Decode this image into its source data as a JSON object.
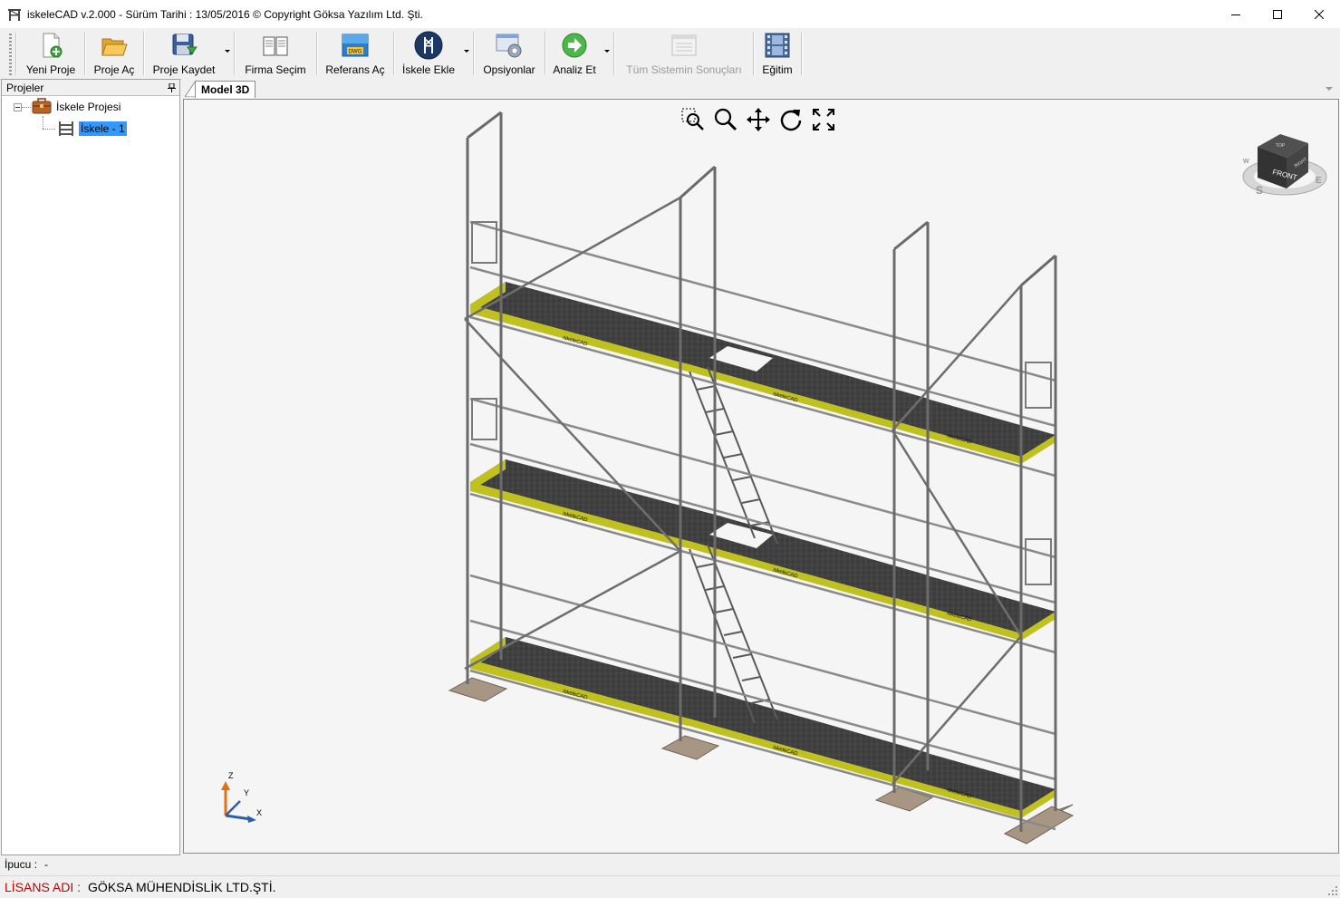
{
  "window": {
    "title": "iskeleCAD v.2.000 - Sürüm Tarihi : 13/05/2016  © Copyright Göksa Yazılım Ltd. Şti."
  },
  "toolbar": {
    "buttons": [
      {
        "label": "Yeni Proje",
        "icon": "new-project-icon"
      },
      {
        "label": "Proje Aç",
        "icon": "folder-open-icon"
      },
      {
        "label": "Proje Kaydet",
        "icon": "save-icon"
      },
      {
        "label": "Firma Seçim",
        "icon": "book-icon"
      },
      {
        "label": "Referans Aç",
        "icon": "dwg-icon"
      },
      {
        "label": "İskele Ekle",
        "icon": "scaffold-add-icon"
      },
      {
        "label": "Opsiyonlar",
        "icon": "options-gear-icon"
      },
      {
        "label": "Analiz Et",
        "icon": "analyze-arrow-icon"
      },
      {
        "label": "Tüm Sistemin Sonuçları",
        "icon": "results-icon"
      },
      {
        "label": "Eğitim",
        "icon": "film-icon"
      }
    ],
    "dwg_badge": "DWG"
  },
  "projects_panel": {
    "title": "Projeler",
    "tree": {
      "root": "İskele Projesi",
      "child": "İskele - 1"
    }
  },
  "tabs": [
    {
      "label": "Model 3D",
      "active": true
    }
  ],
  "viewcube": {
    "face": "FRONT",
    "top_face": "TOP",
    "right_face": "RIGHT",
    "compass": [
      "S",
      "E",
      "W"
    ]
  },
  "axes": {
    "z": "Z",
    "y": "Y",
    "x": "X"
  },
  "planks": {
    "label": "iskeleCAD"
  },
  "status": {
    "tip_label": "İpucu :",
    "tip_value": "-"
  },
  "license": {
    "label": "LİSANS ADI :",
    "value": "GÖKSA MÜHENDİSLİK LTD.ŞTİ."
  },
  "colors": {
    "plank_deck": "#3a3a3a",
    "plank_edge": "#c8c81e",
    "tube": "#6e6e6e",
    "base_plate": "#b09c88",
    "selection": "#3399ff",
    "license_label": "#c00000"
  }
}
